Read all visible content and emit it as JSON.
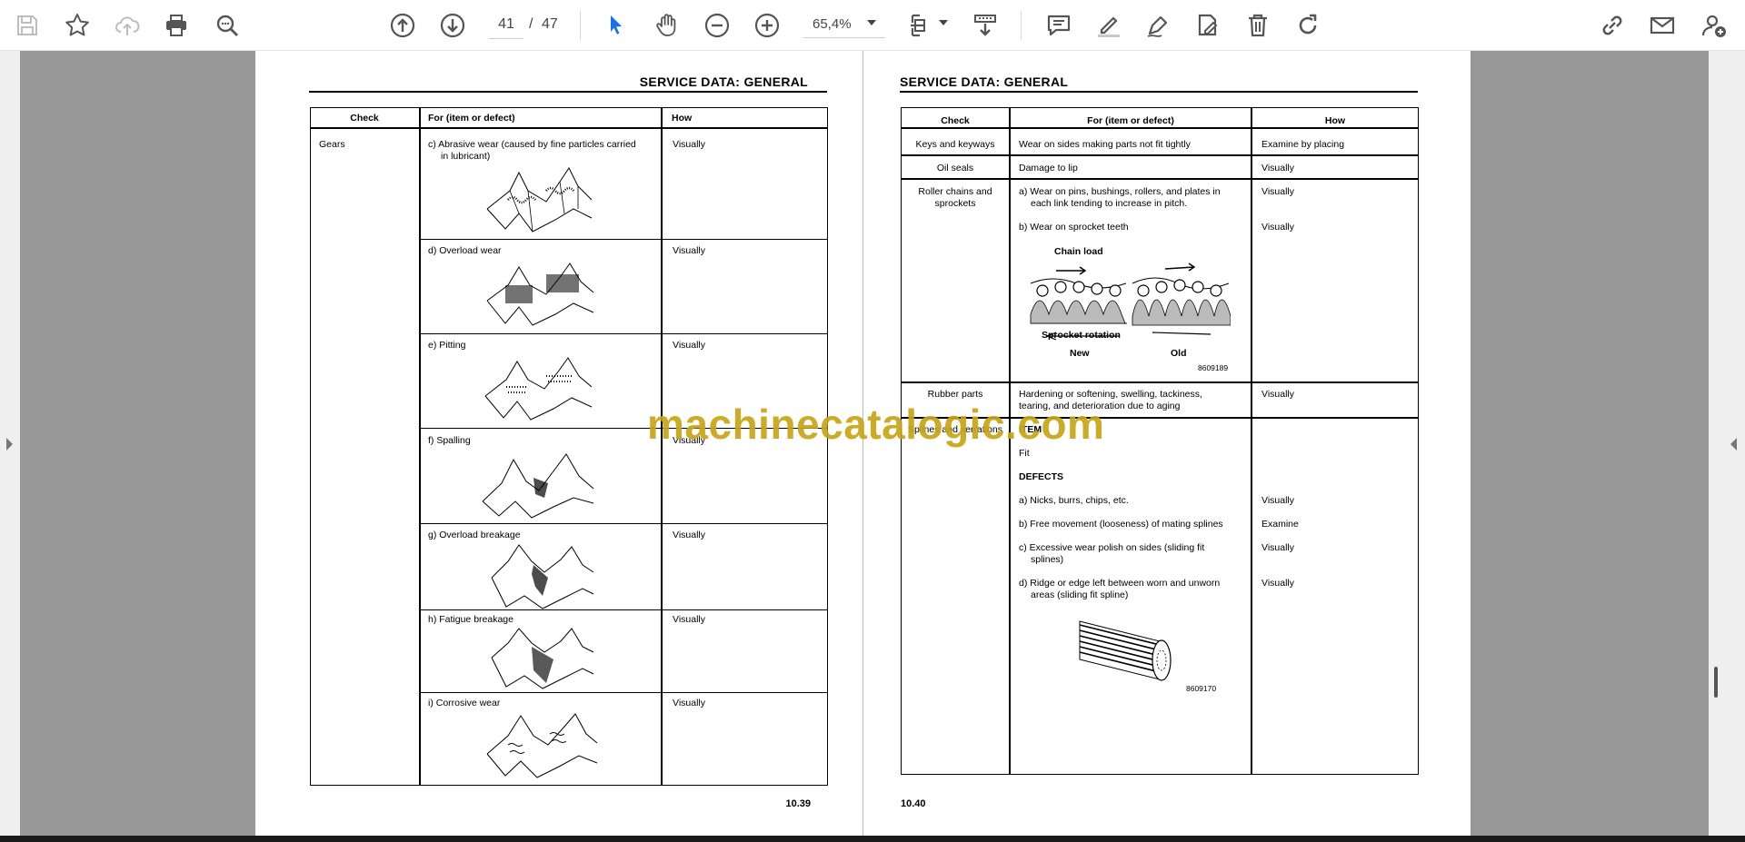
{
  "toolbar": {
    "page_current": "41",
    "page_sep": "/",
    "page_total": "47",
    "zoom": "65,4%"
  },
  "left_page": {
    "header": "SERVICE DATA: GENERAL",
    "columns": [
      "Check",
      "For (item or defect)",
      "How"
    ],
    "group": "Gears",
    "rows": [
      {
        "item": "c) Abrasive wear (caused by fine particles carried",
        "item2": "in lubricant)",
        "how": "Visually"
      },
      {
        "item": "d) Overload wear",
        "how": "Visually"
      },
      {
        "item": "e) Pitting",
        "how": "Visually"
      },
      {
        "item": "f)  Spalling",
        "how": "Visually"
      },
      {
        "item": "g) Overload breakage",
        "how": "Visually"
      },
      {
        "item": "h) Fatigue breakage",
        "how": "Visually"
      },
      {
        "item": "i)  Corrosive wear",
        "how": "Visually"
      }
    ],
    "page_number": "10.39"
  },
  "right_page": {
    "header": "SERVICE DATA: GENERAL",
    "columns": [
      "Check",
      "For (item or defect)",
      "How"
    ],
    "keys": {
      "check": "Keys and keyways",
      "item": "Wear on sides making parts not fit tightly",
      "how": "Examine by placing"
    },
    "oil": {
      "check": "Oil seals",
      "item": "Damage to lip",
      "how": "Visually"
    },
    "roller": {
      "check1": "Roller chains and",
      "check2": "sprockets",
      "item_a1": "a) Wear on pins, bushings, rollers, and plates in",
      "item_a2": "each link tending to increase in pitch.",
      "how_a": "Visually",
      "item_b": "b) Wear on sprocket teeth",
      "how_b": "Visually",
      "fig_chain_load": "Chain load",
      "fig_sprocket_rotation": "Sprocket rotation",
      "fig_new": "New",
      "fig_old": "Old",
      "fig_code": "8609189"
    },
    "rubber": {
      "check": "Rubber parts",
      "item1": "Hardening or softening, swelling, tackiness,",
      "item2": "tearing, and deterioration due to aging",
      "how": "Visually"
    },
    "splines": {
      "check": "Splines and serrations",
      "item_label": "ITEM",
      "fit": "Fit",
      "defects_label": "DEFECTS",
      "a": "a) Nicks, burrs, chips, etc.",
      "a_how": "Visually",
      "b": "b) Free movement (looseness) of mating splines",
      "b_how": "Examine",
      "c1": "c) Excessive wear polish on sides (sliding fit",
      "c2": "splines)",
      "c_how": "Visually",
      "d1": "d) Ridge or edge left between worn and unworn",
      "d2": "areas (sliding fit spline)",
      "d_how": "Visually",
      "fig_code": "8609170"
    },
    "page_number": "10.40"
  },
  "watermark": "machinecatalogic.com"
}
